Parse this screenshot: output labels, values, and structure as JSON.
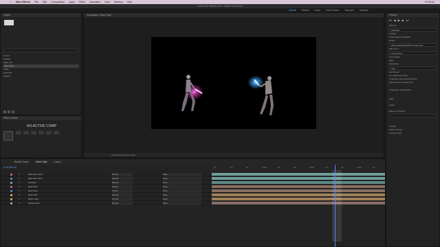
{
  "menubar": {
    "apple": "",
    "app": "After Effects",
    "items": [
      "File",
      "Edit",
      "Composition",
      "Layer",
      "Effect",
      "Animation",
      "View",
      "Window",
      "Help"
    ],
    "clock": "Fri 09:41"
  },
  "titlebar": "Adobe After Effects 2024 - Untitled Project.aep",
  "workspaces": [
    "Default",
    "Review",
    "Learn",
    "Small Screen",
    "Standard",
    "Libraries"
  ],
  "project": {
    "title": "Project",
    "items": [
      "Comp 1",
      "Footage",
      "Saber Left",
      "Saber Right",
      "Solids",
      "Sword Hit",
      "Fight 01"
    ],
    "selected_index": 3
  },
  "effects": {
    "title": "Effect Controls",
    "message": "NO ACTIVE COMP"
  },
  "viewer": {
    "tab": "Composition: Saber Fight",
    "bottom": "Full    Active Camera    1 View"
  },
  "right_panel": {
    "title": "Preview",
    "rows": [
      "Shortcut",
      "Spacebar",
      "Include:",
      "Cache Before Playback",
      "Range",
      "Work Area Extended By Current Time",
      "Play From",
      "Current Time",
      "Frame Rate",
      "Skip",
      "Resolution",
      "Auto",
      "Full Screen",
      "On (Spacebar) Stop:",
      "If caching, play cached frames",
      "Move time to preview time",
      "Properties: No Selection",
      "Align",
      "Audio",
      "Effects & Presets",
      "Tracker",
      "Motion Source",
      "Current Track"
    ]
  },
  "timeline": {
    "tabs": [
      "Render Queue",
      "Saber Fight",
      "Comp 1"
    ],
    "timecode": "0:00:00:12",
    "ruler": [
      "0f",
      "10f",
      "20f",
      "01:00f",
      "10f",
      "20f",
      "02:00f",
      "10f",
      "20f",
      "03:00f",
      "10f"
    ],
    "layers": [
      {
        "num": "1",
        "name": "[light saber pink]",
        "mode": "Normal",
        "parent": "None",
        "color": "#c75b9b"
      },
      {
        "num": "2",
        "name": "[light saber blue]",
        "mode": "Normal",
        "parent": "None",
        "color": "#4d7cc9"
      },
      {
        "num": "3",
        "name": "[hit flash]",
        "mode": "Normal",
        "parent": "None",
        "color": "#6aa1a0"
      },
      {
        "num": "4",
        "name": "[glow pink]",
        "mode": "Screen",
        "parent": "None",
        "color": "#c75b9b"
      },
      {
        "num": "5",
        "name": "[glow blue]",
        "mode": "Screen",
        "parent": "None",
        "color": "#4d7cc9"
      },
      {
        "num": "6",
        "name": "[figure left]",
        "mode": "Normal",
        "parent": "None",
        "color": "#c8a060"
      },
      {
        "num": "7",
        "name": "[figure right]",
        "mode": "Normal",
        "parent": "None",
        "color": "#c8a060"
      },
      {
        "num": "8",
        "name": "[background]",
        "mode": "Normal",
        "parent": "None",
        "color": "#a0a0a0"
      }
    ],
    "track_colors": [
      "#6f9e9a",
      "#6f9e9a",
      "#5d8a86",
      "#8a6f60",
      "#8a6f60",
      "#a0805a",
      "#a0805a",
      "#8a6f6a"
    ]
  },
  "status": "Frame Render Time: 0ms"
}
